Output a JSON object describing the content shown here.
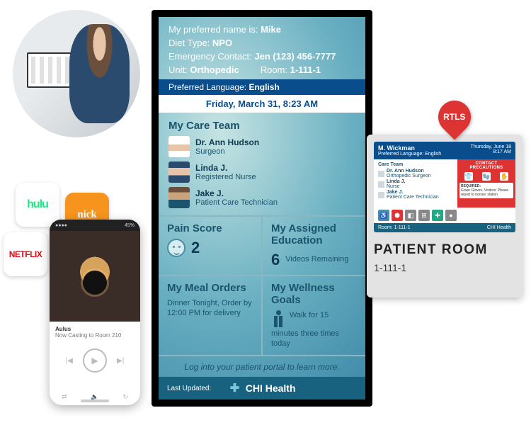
{
  "workstation_alt": "Clinician at workstation",
  "tiles": {
    "hulu": "hulu",
    "nick": "nick",
    "netflix": "NETFLIX"
  },
  "phone": {
    "carrier": "●●●●",
    "battery": "45%",
    "track_title": "Aulus",
    "now_playing": "Now Casting to Room 210",
    "prev": "|◀",
    "play": "▶",
    "next": "▶|"
  },
  "board": {
    "pref_name_label": "My preferred name is:",
    "pref_name": "Mike",
    "diet_label": "Diet Type:",
    "diet": "NPO",
    "contact_label": "Emergency Contact:",
    "contact": "Jen (123) 456-7777",
    "unit_label": "Unit:",
    "unit": "Orthopedic",
    "room_label": "Room:",
    "room": "1-111-1",
    "lang_label": "Preferred Language:",
    "lang": "English",
    "datetime": "Friday, March 31, 8:23 AM",
    "care_team_title": "My Care Team",
    "team": [
      {
        "name": "Dr. Ann Hudson",
        "role": "Surgeon"
      },
      {
        "name": "Linda J.",
        "role": "Registered Nurse"
      },
      {
        "name": "Jake J.",
        "role": "Patient Care Technician"
      }
    ],
    "pain_title": "Pain Score",
    "pain_value": "2",
    "edu_title": "My Assigned Education",
    "edu_count": "6",
    "edu_caption": "Videos Remaining",
    "meal_title": "My Meal Orders",
    "meal_text": "Dinner Tonight, Order by 12:00 PM for delivery",
    "wellness_title": "My Wellness Goals",
    "wellness_text": "Walk for 15 minutes three times today",
    "portal": "Log into your patient portal to learn more.",
    "last_updated_label": "Last Updated:",
    "brand": "CHI Health"
  },
  "rtls_label": "RTLS",
  "mini": {
    "name": "M. Wickman",
    "pref_lang": "Preferred Language: English",
    "date": "Thursday, June 18",
    "time": "8:17 AM",
    "team_title": "Care Team",
    "team": [
      {
        "name": "Dr. Ann Hudson",
        "role": "Orthopedic Surgeon"
      },
      {
        "name": "Linda J.",
        "role": "Nurse"
      },
      {
        "name": "Jake J.",
        "role": "Patient Care Technician"
      }
    ],
    "precaution_title": "CONTACT PRECAUTIONS",
    "precaution_req": "REQUIRED:",
    "precaution_text": "Gown Gloves. Visitors: Please report to nurses' station",
    "room_label": "Room:",
    "room": "1-111-1",
    "brand": "CHI Health"
  },
  "sign": {
    "title": "PATIENT ROOM",
    "number": "1-111-1"
  }
}
